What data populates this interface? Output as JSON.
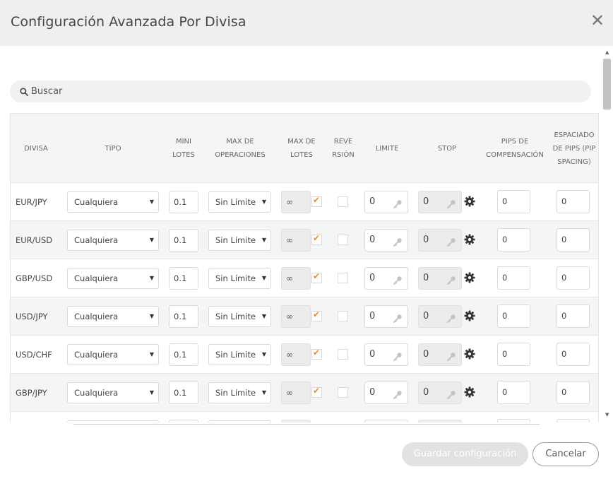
{
  "header": {
    "title": "Configuración Avanzada Por Divisa"
  },
  "search": {
    "placeholder": "Buscar"
  },
  "columns": {
    "divisa": "DIVISA",
    "tipo": "TIPO",
    "mini_lotes": "MINI LOTES",
    "max_operaciones": "MAX DE OPERACIONES",
    "max_lotes": "MAX DE LOTES",
    "reversion": "REVE RSIÓN",
    "limite": "LIMITE",
    "stop": "STOP",
    "pips_compensacion": "PIPS DE COMPENSACIÓN",
    "pip_spacing": "ESPACIADO DE PIPS (PIP SPACING)"
  },
  "rows": [
    {
      "pair": "EUR/JPY",
      "tipo": "Cualquiera",
      "mini_lotes": "0.1",
      "max_operaciones": "Sin Límite",
      "max_lotes": "∞",
      "max_lotes_checked": true,
      "reversion": false,
      "limite": "0",
      "stop": "0",
      "pips_compensacion": "0",
      "pip_spacing": "0"
    },
    {
      "pair": "EUR/USD",
      "tipo": "Cualquiera",
      "mini_lotes": "0.1",
      "max_operaciones": "Sin Límite",
      "max_lotes": "∞",
      "max_lotes_checked": true,
      "reversion": false,
      "limite": "0",
      "stop": "0",
      "pips_compensacion": "0",
      "pip_spacing": "0"
    },
    {
      "pair": "GBP/USD",
      "tipo": "Cualquiera",
      "mini_lotes": "0.1",
      "max_operaciones": "Sin Límite",
      "max_lotes": "∞",
      "max_lotes_checked": true,
      "reversion": false,
      "limite": "0",
      "stop": "0",
      "pips_compensacion": "0",
      "pip_spacing": "0"
    },
    {
      "pair": "USD/JPY",
      "tipo": "Cualquiera",
      "mini_lotes": "0.1",
      "max_operaciones": "Sin Límite",
      "max_lotes": "∞",
      "max_lotes_checked": true,
      "reversion": false,
      "limite": "0",
      "stop": "0",
      "pips_compensacion": "0",
      "pip_spacing": "0"
    },
    {
      "pair": "USD/CHF",
      "tipo": "Cualquiera",
      "mini_lotes": "0.1",
      "max_operaciones": "Sin Límite",
      "max_lotes": "∞",
      "max_lotes_checked": true,
      "reversion": false,
      "limite": "0",
      "stop": "0",
      "pips_compensacion": "0",
      "pip_spacing": "0"
    },
    {
      "pair": "GBP/JPY",
      "tipo": "Cualquiera",
      "mini_lotes": "0.1",
      "max_operaciones": "Sin Límite",
      "max_lotes": "∞",
      "max_lotes_checked": true,
      "reversion": false,
      "limite": "0",
      "stop": "0",
      "pips_compensacion": "0",
      "pip_spacing": "0"
    }
  ],
  "footer": {
    "save_label": "Guardar configuración",
    "cancel_label": "Cancelar"
  },
  "icons": {
    "close": "close-icon",
    "search": "search-icon",
    "key": "key-icon",
    "gear": "gear-icon",
    "check": "checkmark-icon"
  },
  "colors": {
    "accent_check": "#f08a24",
    "header_bg": "#efefef",
    "save_disabled": "#e2e2e2"
  }
}
